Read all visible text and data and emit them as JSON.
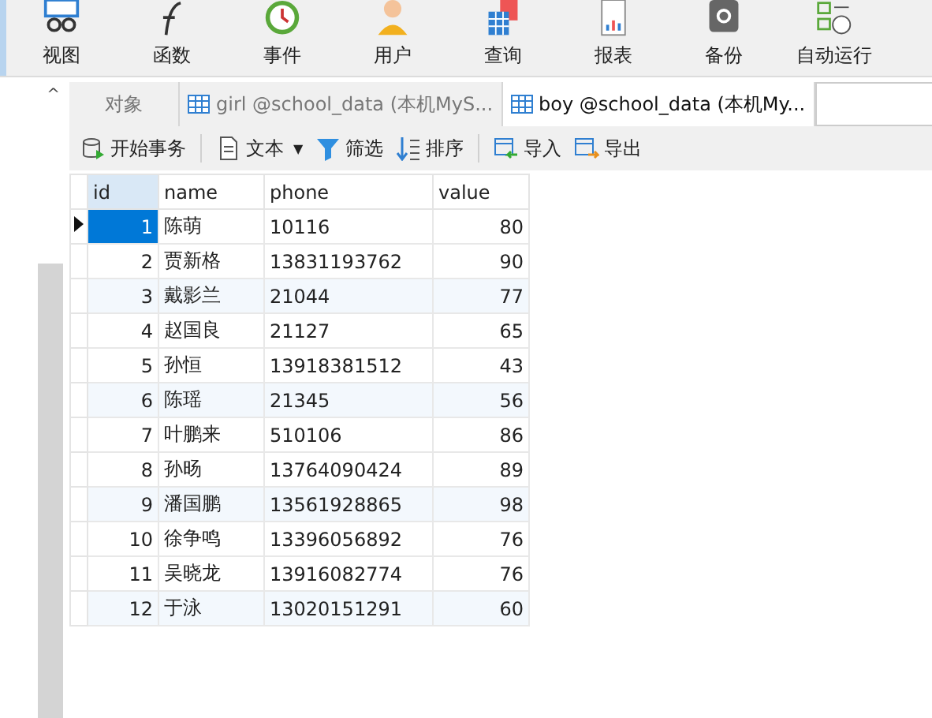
{
  "toolbar": [
    {
      "label": "视图"
    },
    {
      "label": "函数"
    },
    {
      "label": "事件"
    },
    {
      "label": "用户"
    },
    {
      "label": "查询"
    },
    {
      "label": "报表"
    },
    {
      "label": "备份"
    },
    {
      "label": "自动运行"
    }
  ],
  "collapse": "^",
  "tabs": [
    {
      "label": "对象",
      "selected": false,
      "kind": "plain"
    },
    {
      "label": "girl @school_data (本机MyS...",
      "selected": false,
      "kind": "table"
    },
    {
      "label": "boy @school_data (本机My...",
      "selected": true,
      "kind": "table"
    }
  ],
  "actions": [
    {
      "label": "开始事务"
    },
    {
      "label": "文本",
      "dropdown": "▼"
    },
    {
      "label": "筛选"
    },
    {
      "label": "排序"
    },
    {
      "label": "导入"
    },
    {
      "label": "导出"
    }
  ],
  "table": {
    "columns": [
      "id",
      "name",
      "phone",
      "value"
    ],
    "rows": [
      {
        "cells": [
          "1",
          "陈萌",
          "10116",
          "80"
        ],
        "selected": true
      },
      {
        "cells": [
          "2",
          "贾新格",
          "13831193762",
          "90"
        ],
        "selected": false
      },
      {
        "cells": [
          "3",
          "戴影兰",
          "21044",
          "77"
        ],
        "selected": false
      },
      {
        "cells": [
          "4",
          "赵国良",
          "21127",
          "65"
        ],
        "selected": false
      },
      {
        "cells": [
          "5",
          "孙恒",
          "13918381512",
          "43"
        ],
        "selected": false
      },
      {
        "cells": [
          "6",
          "陈瑶",
          "21345",
          "56"
        ],
        "selected": false
      },
      {
        "cells": [
          "7",
          "叶鹏来",
          "510106",
          "86"
        ],
        "selected": false
      },
      {
        "cells": [
          "8",
          "孙旸",
          "13764090424",
          "89"
        ],
        "selected": false
      },
      {
        "cells": [
          "9",
          "潘国鹏",
          "13561928865",
          "98"
        ],
        "selected": false
      },
      {
        "cells": [
          "10",
          "徐争鸣",
          "13396056892",
          "76"
        ],
        "selected": false
      },
      {
        "cells": [
          "11",
          "吴晓龙",
          "13916082774",
          "76"
        ],
        "selected": false
      },
      {
        "cells": [
          "12",
          "于泳",
          "13020151291",
          "60"
        ],
        "selected": false
      }
    ]
  }
}
